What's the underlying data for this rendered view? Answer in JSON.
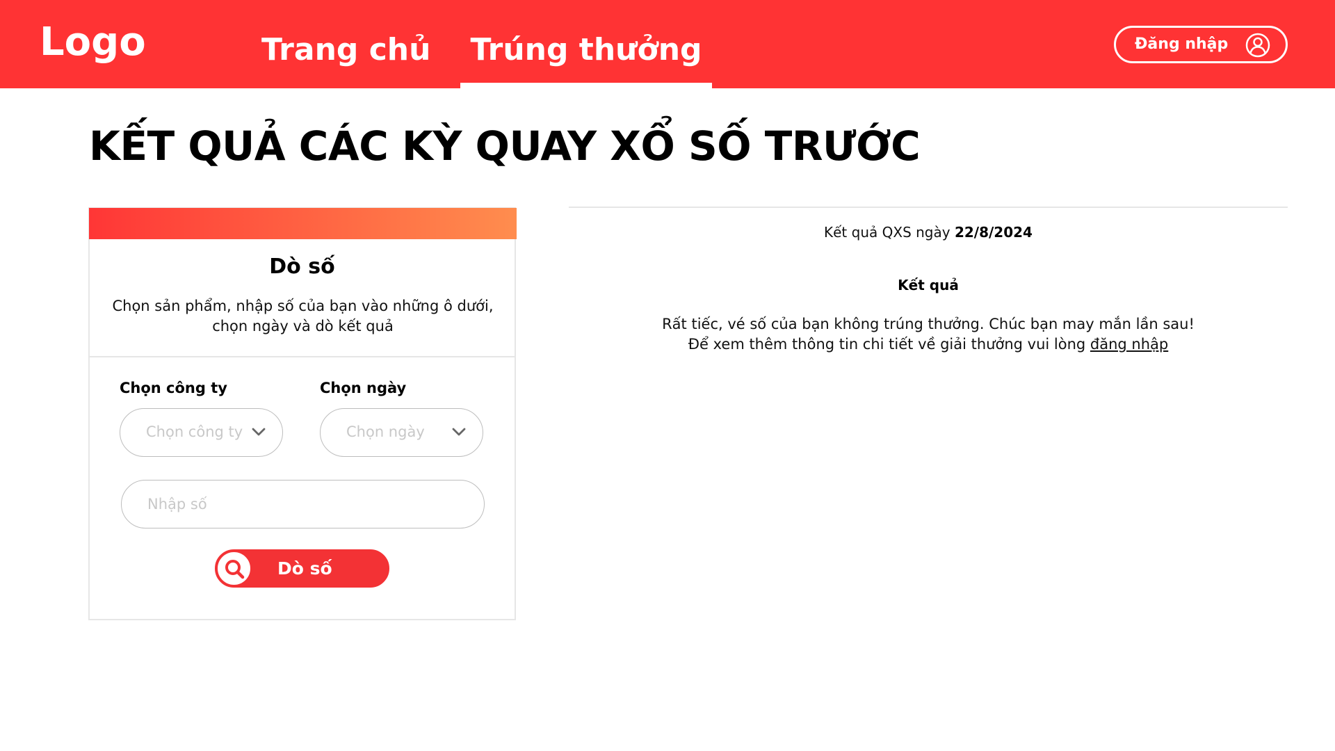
{
  "header": {
    "logo": "Logo",
    "nav": [
      {
        "label": "Trang chủ"
      },
      {
        "label": "Trúng thưởng"
      }
    ],
    "login_label": "Đăng nhập",
    "brand_color": "#ff3334"
  },
  "page": {
    "title": "KẾT QUẢ CÁC KỲ QUAY XỔ SỐ TRƯỚC"
  },
  "card": {
    "heading": "Dò số",
    "description_line1": "Chọn sản phẩm, nhập số của bạn vào những ô dưới,",
    "description_line2": "chọn ngày và dò kết quả",
    "company_label": "Chọn công ty",
    "company_placeholder": "Chọn công ty",
    "date_label": "Chọn ngày",
    "date_placeholder": "Chọn ngày",
    "number_placeholder": "Nhập số",
    "number_value": "",
    "search_button": "Dò số",
    "gradient_start": "#ff3636",
    "gradient_end": "#ff8d4e"
  },
  "result": {
    "date_prefix": "Kết quả QXS ngày ",
    "date_value": "22/8/2024",
    "heading": "Kết quả",
    "message_line1": "Rất tiếc, vé số của bạn không trúng thưởng. Chúc bạn may mắn lần sau!",
    "message_line2": "Để xem thêm thông tin chi tiết về giải thưởng vui lòng ",
    "login_link": "đăng nhập"
  },
  "icons": {
    "user": "user-icon",
    "chevron": "chevron-down-icon",
    "search": "search-icon"
  }
}
